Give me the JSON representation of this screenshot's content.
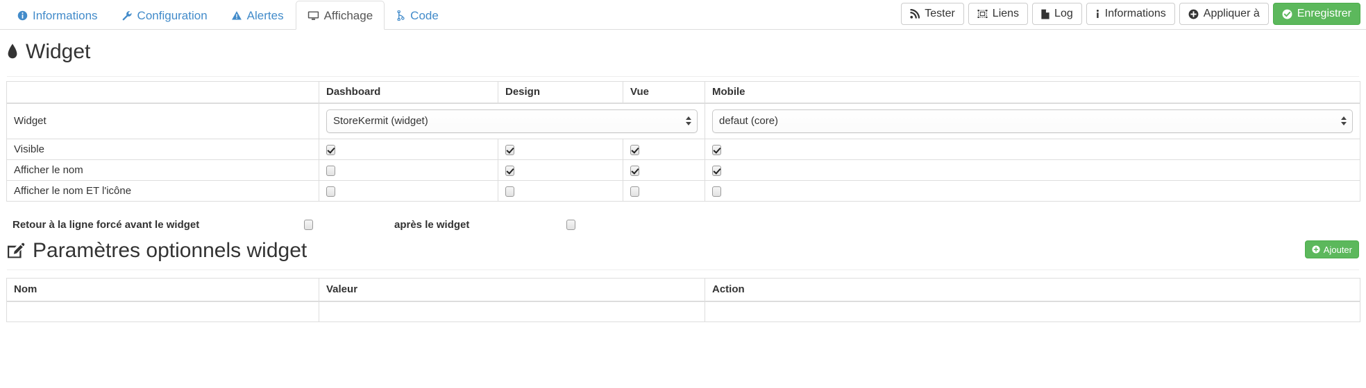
{
  "tabs": [
    {
      "id": "informations",
      "label": "Informations",
      "icon": "info-circle-icon",
      "active": false
    },
    {
      "id": "configuration",
      "label": "Configuration",
      "icon": "wrench-icon",
      "active": false
    },
    {
      "id": "alertes",
      "label": "Alertes",
      "icon": "warning-triangle-icon",
      "active": false
    },
    {
      "id": "affichage",
      "label": "Affichage",
      "icon": "desktop-icon",
      "active": true
    },
    {
      "id": "code",
      "label": "Code",
      "icon": "code-branch-icon",
      "active": false
    }
  ],
  "toolbar": {
    "tester_label": "Tester",
    "tester_icon": "rss-icon",
    "liens_label": "Liens",
    "liens_icon": "object-group-icon",
    "log_label": "Log",
    "log_icon": "file-icon",
    "informations_label": "Informations",
    "informations_icon": "info-icon",
    "appliquer_label": "Appliquer à",
    "appliquer_icon": "plus-circle-icon",
    "enregistrer_label": "Enregistrer",
    "enregistrer_icon": "check-circle-icon"
  },
  "sections": {
    "widget": {
      "title": "Widget",
      "icon": "tint-droplet-icon"
    },
    "params": {
      "title": "Paramètres optionnels widget",
      "icon": "edit-pencil-icon",
      "add_label": "Ajouter",
      "add_icon": "plus-circle-icon"
    }
  },
  "widget_table": {
    "headers": [
      "",
      "Dashboard",
      "Design",
      "Vue",
      "Mobile"
    ],
    "rows": [
      {
        "type": "select",
        "label": "Widget",
        "selects": [
          {
            "name": "widget-template-select",
            "value": "StoreKermit (widget)",
            "span": 3
          },
          {
            "name": "widget-mobile-template-select",
            "value": "defaut (core)",
            "span": 1
          }
        ]
      },
      {
        "type": "checkbox",
        "label": "Visible",
        "checks": [
          true,
          true,
          true,
          true
        ]
      },
      {
        "type": "checkbox",
        "label": "Afficher le nom",
        "checks": [
          false,
          true,
          true,
          true
        ]
      },
      {
        "type": "checkbox",
        "label": "Afficher le nom ET l'icône",
        "checks": [
          false,
          false,
          false,
          false
        ]
      }
    ]
  },
  "line_break": {
    "before_label": "Retour à la ligne forcé avant le widget",
    "before_checked": false,
    "after_label": "après le widget",
    "after_checked": false
  },
  "params_table": {
    "headers": [
      "Nom",
      "Valeur",
      "Action"
    ],
    "rows": []
  },
  "colors": {
    "link": "#428bca",
    "success": "#5cb85c",
    "border": "#dddddd",
    "text": "#333333"
  }
}
